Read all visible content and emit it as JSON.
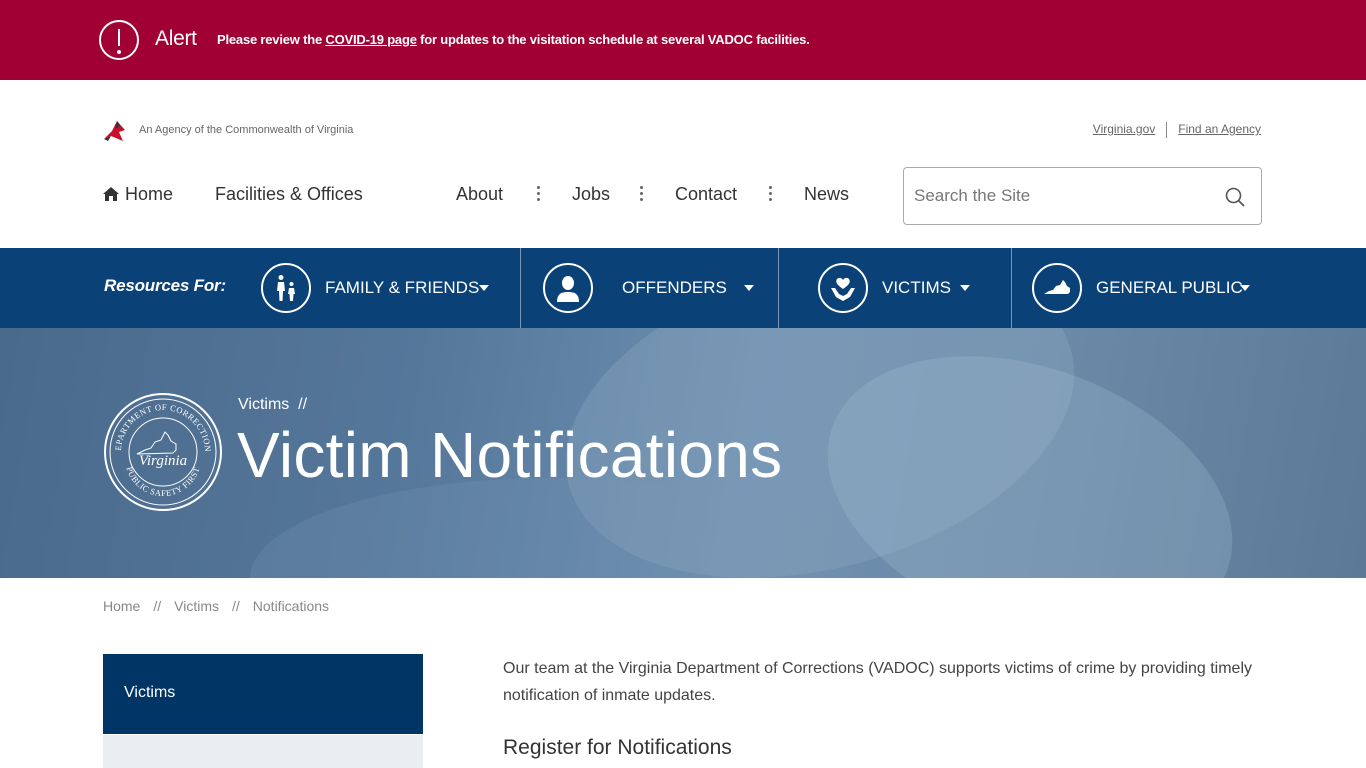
{
  "alert": {
    "title": "Alert",
    "msg_prefix": "Please review the ",
    "link_text": "COVID-19 page",
    "msg_suffix": " for updates to the visitation schedule at several VADOC facilities.",
    "bg_color": "#a00033",
    "icon": "exclamation-circle-icon"
  },
  "agency": {
    "text": "An Agency of the Commonwealth of Virginia",
    "links": [
      "Virginia.gov",
      "Find an Agency"
    ]
  },
  "nav": {
    "home": "Home",
    "facilities": "Facilities & Offices",
    "about": "About",
    "jobs": "Jobs",
    "contact": "Contact",
    "news": "News"
  },
  "search": {
    "placeholder": "Search the Site",
    "value": ""
  },
  "resources": {
    "label": "Resources For:",
    "tabs": [
      {
        "label": "FAMILY & FRIENDS",
        "icon": "family-icon"
      },
      {
        "label": "OFFENDERS",
        "icon": "person-icon"
      },
      {
        "label": "VICTIMS",
        "icon": "heart-hands-icon"
      },
      {
        "label": "GENERAL PUBLIC",
        "icon": "virginia-map-icon"
      }
    ],
    "bg_color": "#0a4278"
  },
  "hero": {
    "crumb": "Victims",
    "crumb_sep": "//",
    "title": "Victim Notifications",
    "seal_top": "DEPARTMENT OF CORRECTIONS",
    "seal_mid": "Virginia",
    "seal_bottom": "PUBLIC SAFETY FIRST"
  },
  "breadcrumb": [
    "Home",
    "Victims",
    "Notifications"
  ],
  "breadcrumb_sep": "//",
  "sidenav": {
    "title": "Victims",
    "color": "#003566"
  },
  "content": {
    "intro": "Our team at the Virginia Department of Corrections (VADOC) supports victims of crime by providing timely notification of inmate updates.",
    "heading": "Register for Notifications"
  }
}
